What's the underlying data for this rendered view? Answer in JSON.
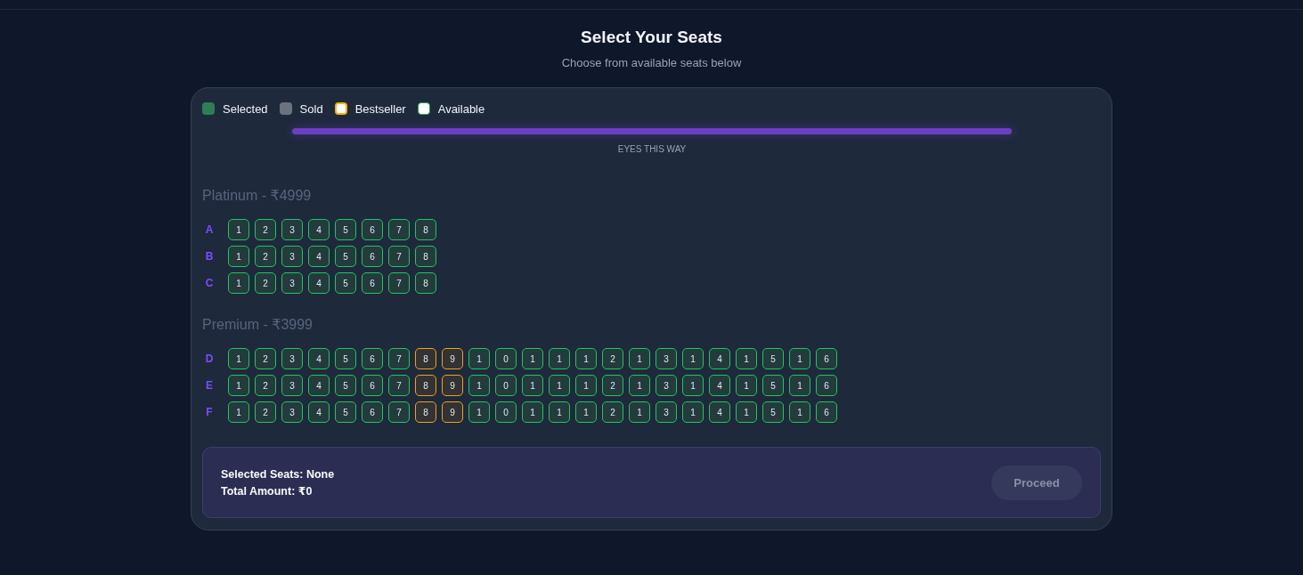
{
  "header": {
    "title": "Select Your Seats",
    "subtitle": "Choose from available seats below"
  },
  "legend": [
    {
      "label": "Selected",
      "kind": "selected"
    },
    {
      "label": "Sold",
      "kind": "sold"
    },
    {
      "label": "Bestseller",
      "kind": "bestseller"
    },
    {
      "label": "Available",
      "kind": "available"
    }
  ],
  "screen": {
    "label": "EYES THIS WAY"
  },
  "sections": [
    {
      "title": "Platinum - ₹4999",
      "rows": [
        {
          "label": "A",
          "seats": [
            {
              "label": "1",
              "kind": "available"
            },
            {
              "label": "2",
              "kind": "available"
            },
            {
              "label": "3",
              "kind": "available"
            },
            {
              "label": "4",
              "kind": "available"
            },
            {
              "label": "5",
              "kind": "available"
            },
            {
              "label": "6",
              "kind": "available"
            },
            {
              "label": "7",
              "kind": "available"
            },
            {
              "label": "8",
              "kind": "available"
            }
          ]
        },
        {
          "label": "B",
          "seats": [
            {
              "label": "1",
              "kind": "available"
            },
            {
              "label": "2",
              "kind": "available"
            },
            {
              "label": "3",
              "kind": "available"
            },
            {
              "label": "4",
              "kind": "available"
            },
            {
              "label": "5",
              "kind": "available"
            },
            {
              "label": "6",
              "kind": "available"
            },
            {
              "label": "7",
              "kind": "available"
            },
            {
              "label": "8",
              "kind": "available"
            }
          ]
        },
        {
          "label": "C",
          "seats": [
            {
              "label": "1",
              "kind": "available"
            },
            {
              "label": "2",
              "kind": "available"
            },
            {
              "label": "3",
              "kind": "available"
            },
            {
              "label": "4",
              "kind": "available"
            },
            {
              "label": "5",
              "kind": "available"
            },
            {
              "label": "6",
              "kind": "available"
            },
            {
              "label": "7",
              "kind": "available"
            },
            {
              "label": "8",
              "kind": "available"
            }
          ]
        }
      ]
    },
    {
      "title": "Premium - ₹3999",
      "rows": [
        {
          "label": "D",
          "seats": [
            {
              "label": "1",
              "kind": "available"
            },
            {
              "label": "2",
              "kind": "available"
            },
            {
              "label": "3",
              "kind": "available"
            },
            {
              "label": "4",
              "kind": "available"
            },
            {
              "label": "5",
              "kind": "available"
            },
            {
              "label": "6",
              "kind": "available"
            },
            {
              "label": "7",
              "kind": "available"
            },
            {
              "label": "8",
              "kind": "bestseller"
            },
            {
              "label": "9",
              "kind": "bestseller"
            },
            {
              "label": "1",
              "kind": "available"
            },
            {
              "label": "0",
              "kind": "available"
            },
            {
              "label": "1",
              "kind": "available"
            },
            {
              "label": "1",
              "kind": "available"
            },
            {
              "label": "1",
              "kind": "available"
            },
            {
              "label": "2",
              "kind": "available"
            },
            {
              "label": "1",
              "kind": "available"
            },
            {
              "label": "3",
              "kind": "available"
            },
            {
              "label": "1",
              "kind": "available"
            },
            {
              "label": "4",
              "kind": "available"
            },
            {
              "label": "1",
              "kind": "available"
            },
            {
              "label": "5",
              "kind": "available"
            },
            {
              "label": "1",
              "kind": "available"
            },
            {
              "label": "6",
              "kind": "available"
            }
          ]
        },
        {
          "label": "E",
          "seats": [
            {
              "label": "1",
              "kind": "available"
            },
            {
              "label": "2",
              "kind": "available"
            },
            {
              "label": "3",
              "kind": "available"
            },
            {
              "label": "4",
              "kind": "available"
            },
            {
              "label": "5",
              "kind": "available"
            },
            {
              "label": "6",
              "kind": "available"
            },
            {
              "label": "7",
              "kind": "available"
            },
            {
              "label": "8",
              "kind": "bestseller"
            },
            {
              "label": "9",
              "kind": "bestseller"
            },
            {
              "label": "1",
              "kind": "available"
            },
            {
              "label": "0",
              "kind": "available"
            },
            {
              "label": "1",
              "kind": "available"
            },
            {
              "label": "1",
              "kind": "available"
            },
            {
              "label": "1",
              "kind": "available"
            },
            {
              "label": "2",
              "kind": "available"
            },
            {
              "label": "1",
              "kind": "available"
            },
            {
              "label": "3",
              "kind": "available"
            },
            {
              "label": "1",
              "kind": "available"
            },
            {
              "label": "4",
              "kind": "available"
            },
            {
              "label": "1",
              "kind": "available"
            },
            {
              "label": "5",
              "kind": "available"
            },
            {
              "label": "1",
              "kind": "available"
            },
            {
              "label": "6",
              "kind": "available"
            }
          ]
        },
        {
          "label": "F",
          "seats": [
            {
              "label": "1",
              "kind": "available"
            },
            {
              "label": "2",
              "kind": "available"
            },
            {
              "label": "3",
              "kind": "available"
            },
            {
              "label": "4",
              "kind": "available"
            },
            {
              "label": "5",
              "kind": "available"
            },
            {
              "label": "6",
              "kind": "available"
            },
            {
              "label": "7",
              "kind": "available"
            },
            {
              "label": "8",
              "kind": "bestseller"
            },
            {
              "label": "9",
              "kind": "bestseller"
            },
            {
              "label": "1",
              "kind": "available"
            },
            {
              "label": "0",
              "kind": "available"
            },
            {
              "label": "1",
              "kind": "available"
            },
            {
              "label": "1",
              "kind": "available"
            },
            {
              "label": "1",
              "kind": "available"
            },
            {
              "label": "2",
              "kind": "available"
            },
            {
              "label": "1",
              "kind": "available"
            },
            {
              "label": "3",
              "kind": "available"
            },
            {
              "label": "1",
              "kind": "available"
            },
            {
              "label": "4",
              "kind": "available"
            },
            {
              "label": "1",
              "kind": "available"
            },
            {
              "label": "5",
              "kind": "available"
            },
            {
              "label": "1",
              "kind": "available"
            },
            {
              "label": "6",
              "kind": "available"
            }
          ]
        }
      ]
    }
  ],
  "summary": {
    "selected_seats": "Selected Seats: None",
    "total": "Total Amount: ₹0"
  },
  "proceed": {
    "label": "Proceed",
    "disabled": true
  }
}
